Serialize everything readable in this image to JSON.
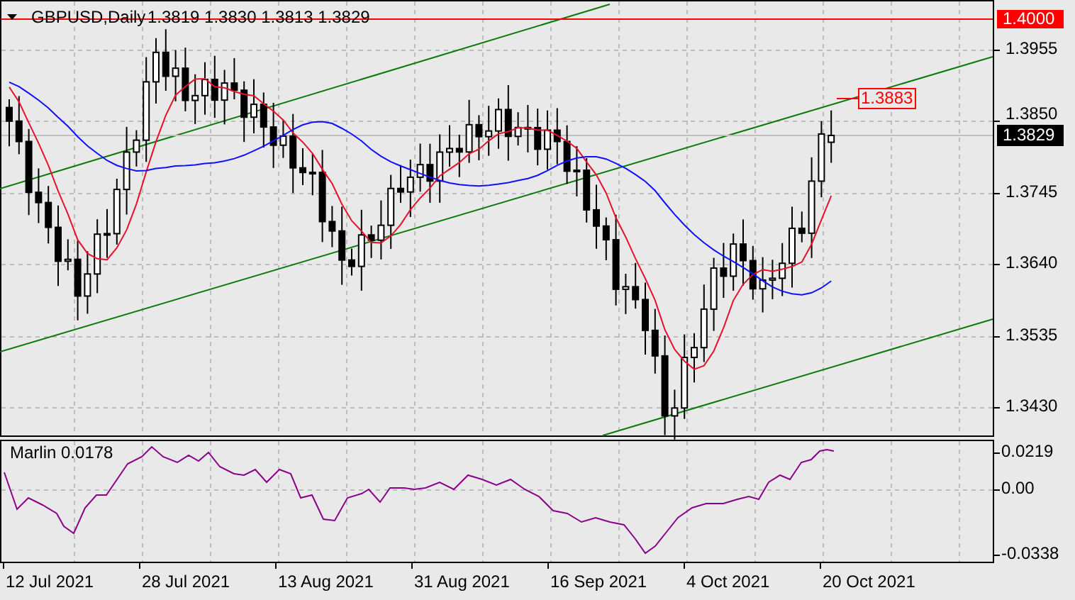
{
  "chart": {
    "symbol": "GBPUSD,Daily",
    "quote": "1.3819 1.3830 1.3813 1.3829",
    "price_axis": [
      "1.3955",
      "1.3850",
      "1.3745",
      "1.3640",
      "1.3535",
      "1.3430"
    ],
    "level_line_label": "1.4000",
    "current_price_label": "1.3829",
    "channel_price_label": "1.3883"
  },
  "indicator": {
    "label": "Marlin 0.0178",
    "axis": [
      "0.0219",
      "0.00",
      "-0.0338"
    ]
  },
  "time_axis": [
    "12 Jul 2021",
    "28 Jul 2021",
    "13 Aug 2021",
    "31 Aug 2021",
    "16 Sep 2021",
    "4 Oct 2021",
    "20 Oct 2021"
  ]
}
